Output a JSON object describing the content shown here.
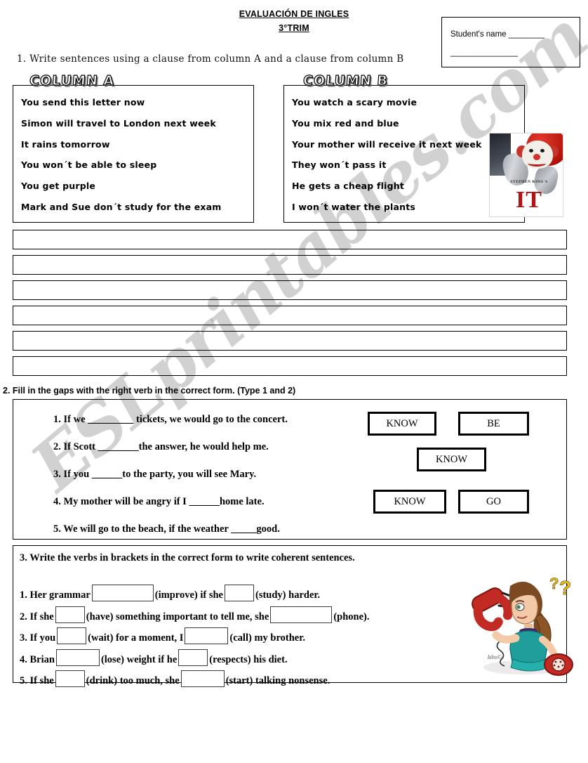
{
  "header": {
    "title_line1": "EVALUACIÓN DE INGLES",
    "title_line2": "3°TRIM"
  },
  "student_box": {
    "label_line": "Student's name ________",
    "blank_line": "_______________"
  },
  "exercise1": {
    "instruction": "1. Write sentences using a clause from column A and a clause from column B",
    "column_a_title": "COLUMN A",
    "column_b_title": "COLUMN B",
    "column_a": [
      "You send this letter now",
      "Simon will travel to London next week",
      "It rains tomorrow",
      "You won´t be able to sleep",
      "You get purple",
      "Mark and Sue don´t study for the exam"
    ],
    "column_b": [
      "You watch a scary movie",
      "You mix red and blue",
      "Your mother will receive it next week",
      "They won´t pass it",
      "He gets a cheap flight",
      "I won´t water the plants"
    ],
    "answer_rows": [
      "",
      "",
      "",
      "",
      "",
      ""
    ],
    "poster": {
      "icon": "it-movie-poster",
      "author_line": "STEPHEN KING'S",
      "title": "IT"
    }
  },
  "exercise2": {
    "instruction": "2. Fill in the gaps with the right verb in the correct form. (Type 1 and 2)",
    "items": [
      "1.  If we _________ tickets, we would go to the concert.",
      "2. If Scott ________the answer, he would help me.",
      "3. If you ______to the party, you will see Mary.",
      "4. My mother will be angry if I ______home late.",
      "5. We will go to the beach, if the weather _____good."
    ],
    "verb_boxes": [
      {
        "label": "KNOW"
      },
      {
        "label": "BE"
      },
      {
        "label": "KNOW"
      },
      {
        "label": "KNOW"
      },
      {
        "label": "GO"
      }
    ]
  },
  "exercise3": {
    "instruction": "3. Write the verbs in brackets in the correct form to write coherent sentences.",
    "items": [
      {
        "number": "1.",
        "parts": [
          "Her grammar",
          "(improve) if she",
          "(study) harder."
        ],
        "boxes": [
          "lg",
          "sm"
        ]
      },
      {
        "number": "2.",
        "parts": [
          "If she",
          "(have) something important to tell me, she",
          "(phone)."
        ],
        "boxes": [
          "sm",
          "lg"
        ]
      },
      {
        "number": "3.",
        "parts": [
          "If you",
          "(wait) for a moment, I",
          "(call) my brother."
        ],
        "boxes": [
          "sm",
          "md"
        ]
      },
      {
        "number": "4.",
        "parts": [
          "Brian",
          "(lose) weight if he",
          "(respects) his diet."
        ],
        "boxes": [
          "md",
          "sm"
        ]
      },
      {
        "number": "5.",
        "parts": [
          "If she",
          "(drink) too much, she",
          "(start) talking nonsense."
        ],
        "boxes": [
          "sm",
          "md"
        ]
      }
    ],
    "clipart": {
      "icon": "girl-on-telephone-icon",
      "signature": "kibo©"
    }
  },
  "watermark": {
    "text": "ESLprintables.com",
    "color": "#d9d9d9"
  }
}
